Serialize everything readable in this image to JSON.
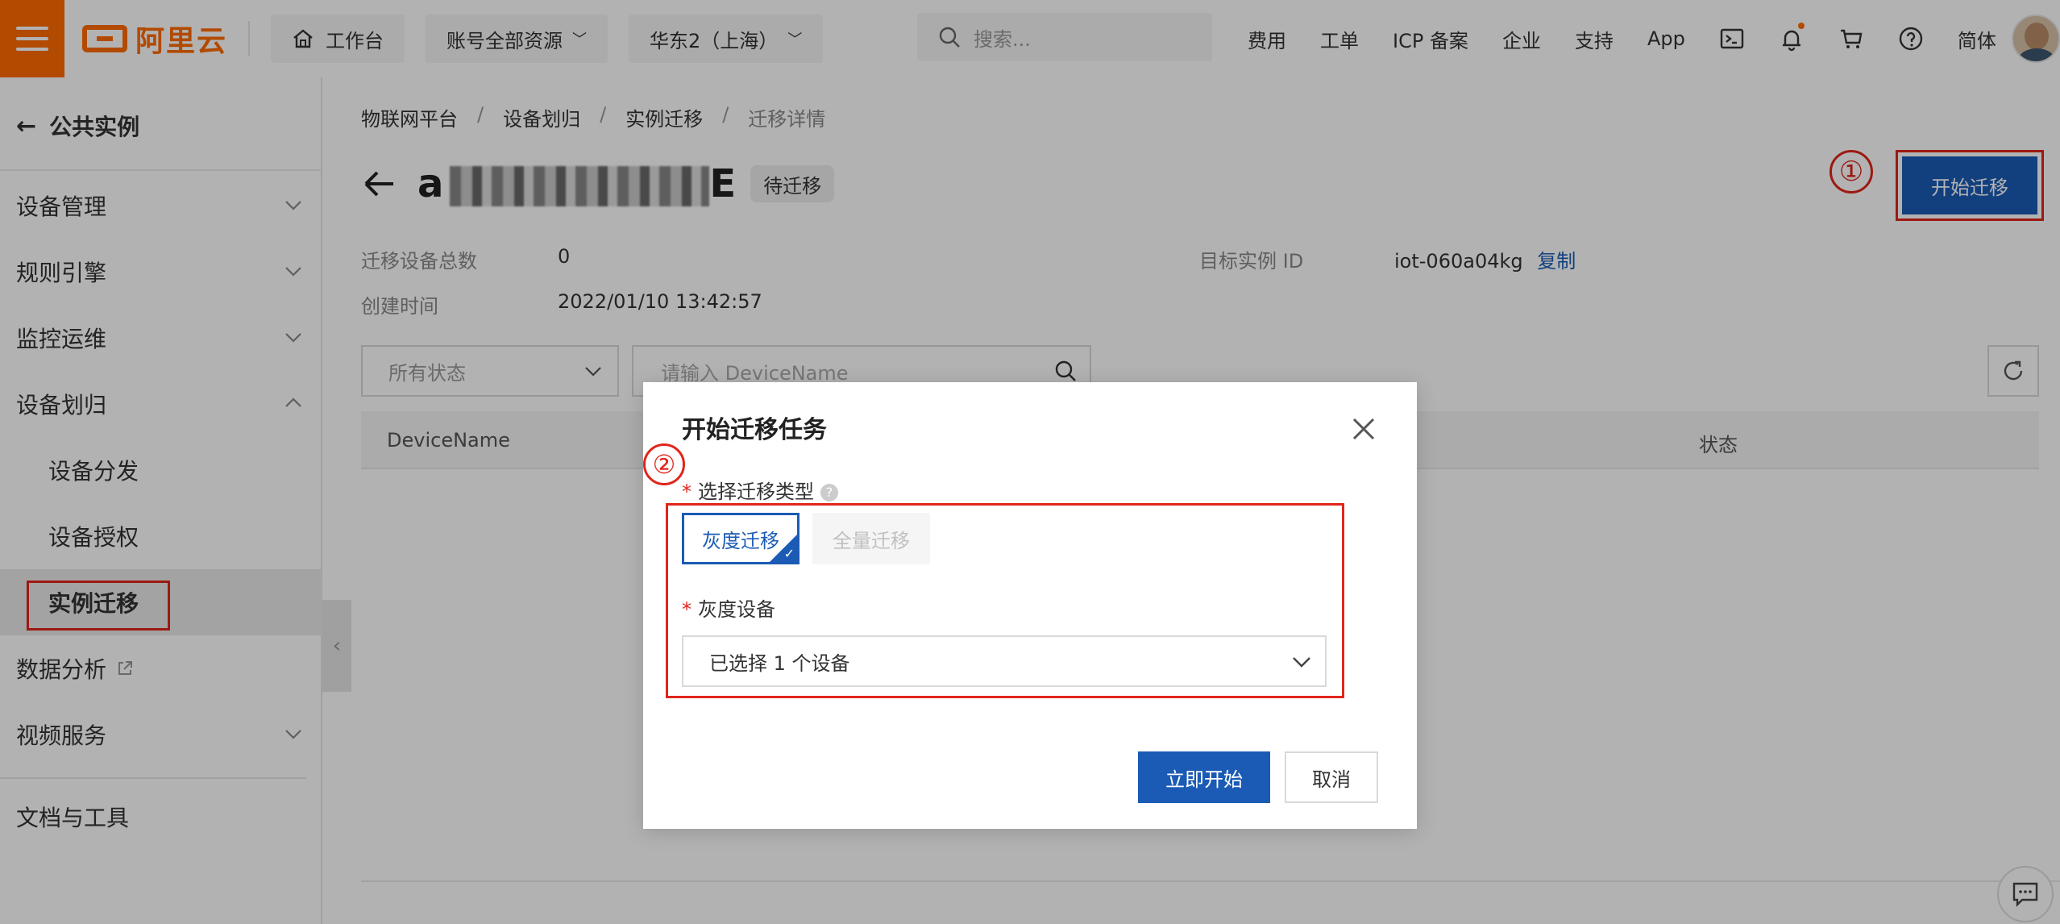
{
  "topbar": {
    "logo_text": "阿里云",
    "workbench_label": "工作台",
    "resource_label": "账号全部资源",
    "region_label": "华东2（上海）",
    "search_placeholder": "搜索...",
    "links": [
      "费用",
      "工单",
      "ICP 备案",
      "企业",
      "支持",
      "App"
    ],
    "lang_label": "简体",
    "icons": [
      "terminal-icon",
      "bell-icon",
      "cart-icon",
      "help-icon"
    ],
    "brand_color": "#ff6a00"
  },
  "sidebar": {
    "back_label": "公共实例",
    "items": [
      {
        "label": "设备管理",
        "expanded": false
      },
      {
        "label": "规则引擎",
        "expanded": false
      },
      {
        "label": "监控运维",
        "expanded": false
      },
      {
        "label": "设备划归",
        "expanded": true
      },
      {
        "label": "设备分发"
      },
      {
        "label": "设备授权"
      },
      {
        "label": "实例迁移",
        "active": true
      },
      {
        "label": "数据分析",
        "external": true
      },
      {
        "label": "视频服务",
        "expanded": false
      },
      {
        "label": "文档与工具"
      }
    ]
  },
  "main": {
    "breadcrumb": [
      "物联网平台",
      "设备划归",
      "实例迁移",
      "迁移详情"
    ],
    "title_prefix": "a",
    "title_suffix": "E",
    "status_badge": "待迁移",
    "start_button": "开始迁移",
    "annotation_1": "①",
    "info": {
      "device_total_label": "迁移设备总数",
      "device_total_value": "0",
      "created_label": "创建时间",
      "created_value": "2022/01/10 13:42:57",
      "target_label": "目标实例 ID",
      "target_value": "iot-060a04kg",
      "copy_label": "复制"
    },
    "filter": {
      "status_select": "所有状态",
      "search_placeholder": "请输入 DeviceName"
    },
    "table": {
      "columns": [
        "DeviceName",
        "状态"
      ]
    }
  },
  "dialog": {
    "title": "开始迁移任务",
    "annotation_2": "②",
    "type_label": "选择迁移类型",
    "type_options": [
      {
        "label": "灰度迁移",
        "selected": true
      },
      {
        "label": "全量迁移",
        "selected": false,
        "disabled": true
      }
    ],
    "device_label": "灰度设备",
    "device_select_value": "已选择 1 个设备",
    "confirm_button": "立即开始",
    "cancel_button": "取消",
    "accent_color": "#1b5bb5",
    "highlight_color": "#e1251b"
  }
}
